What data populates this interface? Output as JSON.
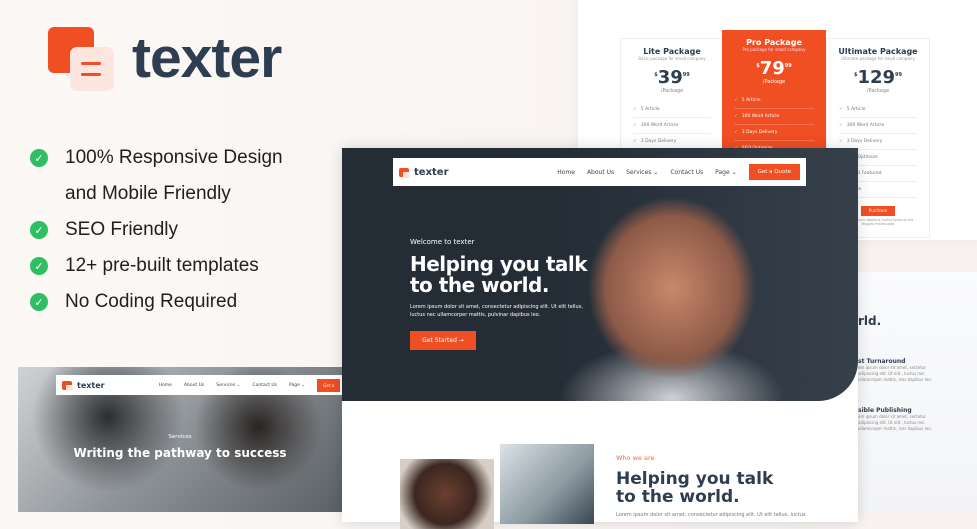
{
  "brand": {
    "name": "texter",
    "accent": "#f04e23"
  },
  "features": [
    {
      "text": "100% Responsive Design",
      "check": true
    },
    {
      "text": "and Mobile Friendly",
      "check": false
    },
    {
      "text": "SEO Friendly",
      "check": true
    },
    {
      "text": "12+ pre-built templates",
      "check": true
    },
    {
      "text": "No Coding Required",
      "check": true
    }
  ],
  "pricing": [
    {
      "name": "Lite Package",
      "sub": "Basic package for small company",
      "currency": "$",
      "price": "39",
      "cents": "99",
      "per": "/Package",
      "items": [
        "5 Article",
        "300 Word Article",
        "3 Days Delivery",
        "SEO Optimize"
      ]
    },
    {
      "name": "Pro Package",
      "sub": "Pro package for small company",
      "currency": "$",
      "price": "79",
      "cents": "99",
      "per": "/Package",
      "items": [
        "5 Article",
        "300 Word Article",
        "3 Days Delivery",
        "SEO Optimize"
      ]
    },
    {
      "name": "Ultimate Package",
      "sub": "Ultimate package for small company",
      "currency": "$",
      "price": "129",
      "cents": "99",
      "per": "/Package",
      "items": [
        "5 Article",
        "300 Word Article",
        "3 Days Delivery",
        "SEO Optimize",
        "Brand Featured",
        "Article"
      ],
      "button": "Purchase",
      "note": "Lorem ipsum dapibus luctus tempus elit feugiat malesuada"
    }
  ],
  "nav": {
    "logo": "texter",
    "items": [
      "Home",
      "About Us",
      "Services ⌄",
      "Contact Us",
      "Page ⌄"
    ],
    "cta": "Get a Quote"
  },
  "hero": {
    "welcome": "Welcome to texter",
    "title": "Helping you talk to the world.",
    "lead": "Lorem ipsum dolor sit amet, consectetur adipiscing elit. Ut elit tellus, luctus nec ullamcorper mattis, pulvinar dapibus leo.",
    "button": "Get Started  →"
  },
  "about": {
    "eyebrow": "Who we are",
    "title": "Helping you talk to the world.",
    "lead": "Lorem ipsum dolor sit amet, consectetur adipiscing elit. Ut elit tellus, luctus"
  },
  "right": {
    "heading": "rld.",
    "f1": "st Turnaround",
    "f2": "sible Publishing",
    "body": "em ipsum dolor sit amet, sectetur adipiscing elit. Ut elit , luctus nec ullamcorper mattis, inar dapibus leo."
  },
  "services": {
    "nav_items": [
      "Home",
      "About Us",
      "Services ⌄",
      "Contact Us",
      "Page ⌄"
    ],
    "cta": "Get a",
    "eyebrow": "Services",
    "title": "Writing the pathway to success"
  }
}
